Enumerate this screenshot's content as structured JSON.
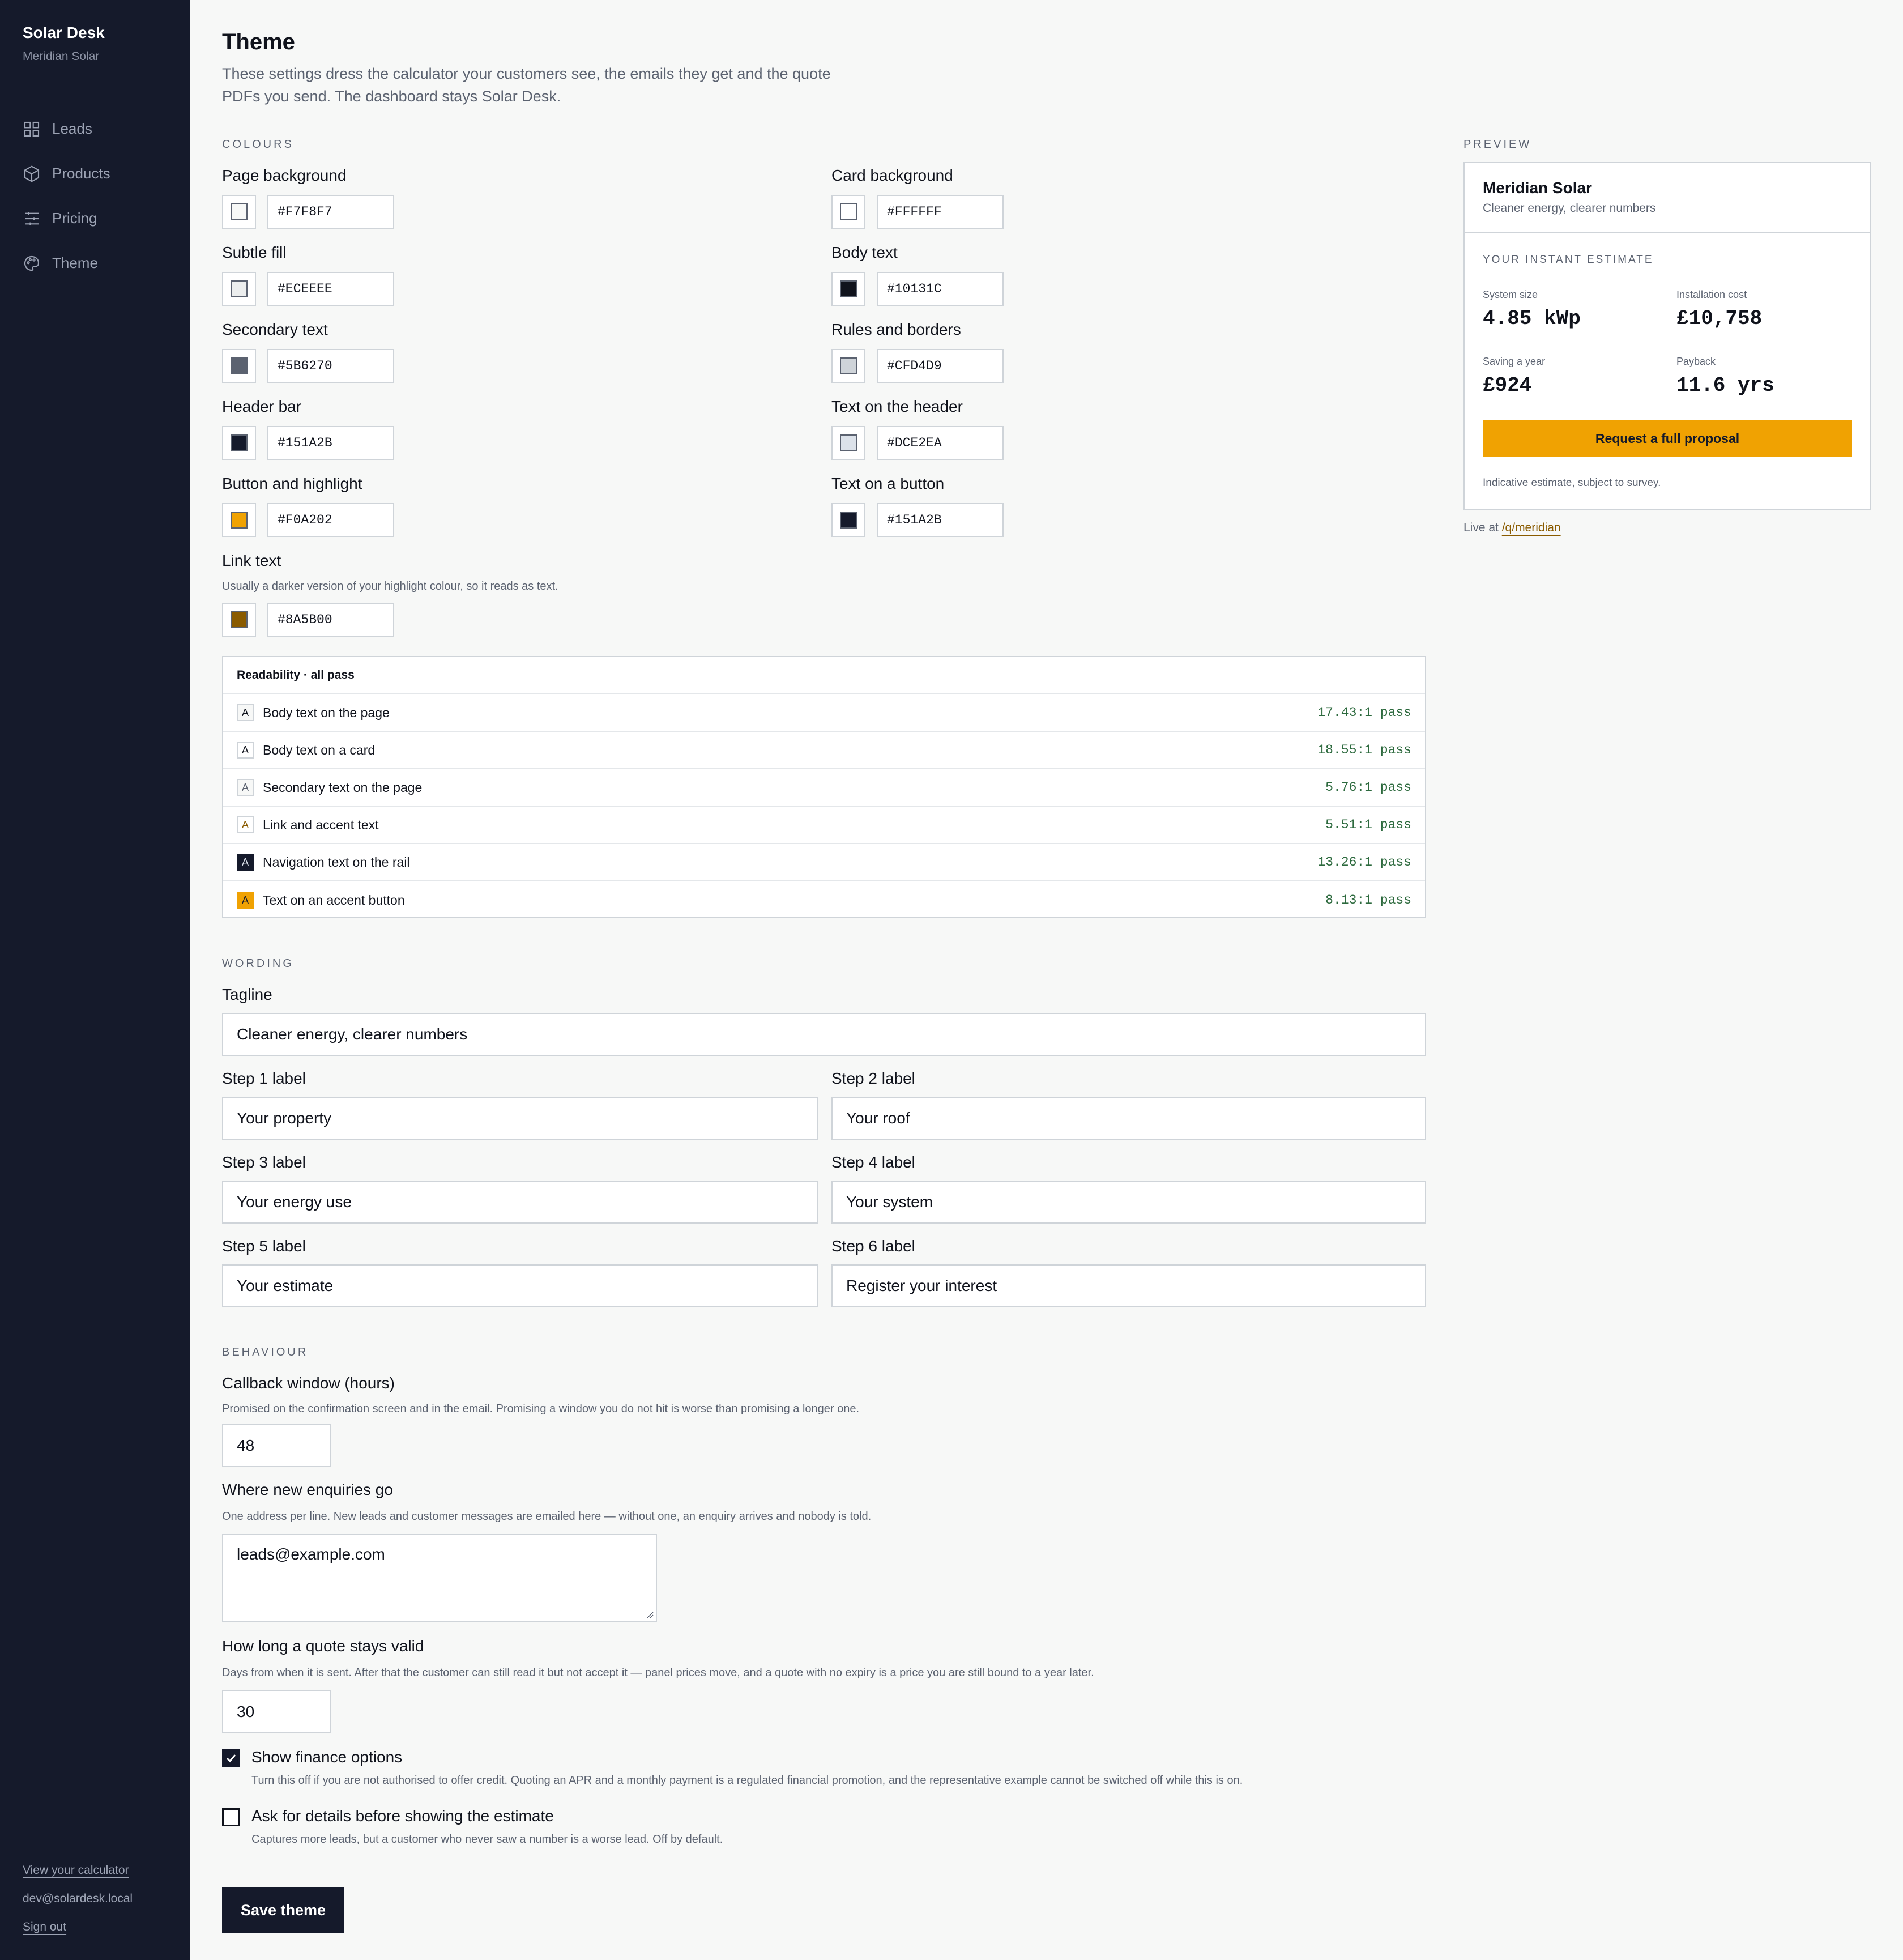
{
  "sidebar": {
    "brand": "Solar Desk",
    "company": "Meridian Solar",
    "items": [
      {
        "label": "Leads",
        "icon": "grid-icon"
      },
      {
        "label": "Products",
        "icon": "box-icon"
      },
      {
        "label": "Pricing",
        "icon": "sliders-icon"
      },
      {
        "label": "Theme",
        "icon": "palette-icon"
      }
    ],
    "footer": {
      "view_calculator": "View your calculator",
      "email": "dev@solardesk.local",
      "sign_out": "Sign out"
    }
  },
  "page": {
    "title": "Theme",
    "intro": "These settings dress the calculator your customers see, the emails they get and the quote PDFs you send. The dashboard stays Solar Desk."
  },
  "colours": {
    "section_label": "COLOURS",
    "page_background": {
      "label": "Page background",
      "value": "#F7F8F7"
    },
    "card_background": {
      "label": "Card background",
      "value": "#FFFFFF"
    },
    "subtle_fill": {
      "label": "Subtle fill",
      "value": "#ECEEEE"
    },
    "body_text": {
      "label": "Body text",
      "value": "#10131C"
    },
    "secondary_text": {
      "label": "Secondary text",
      "value": "#5B6270"
    },
    "rules_borders": {
      "label": "Rules and borders",
      "value": "#CFD4D9"
    },
    "header_bar": {
      "label": "Header bar",
      "value": "#151A2B"
    },
    "text_on_header": {
      "label": "Text on the header",
      "value": "#DCE2EA"
    },
    "button_highlight": {
      "label": "Button and highlight",
      "value": "#F0A202"
    },
    "text_on_button": {
      "label": "Text on a button",
      "value": "#151A2B"
    },
    "link_text": {
      "label": "Link text",
      "help": "Usually a darker version of your highlight colour, so it reads as text.",
      "value": "#8A5B00"
    }
  },
  "readability": {
    "title": "Readability · all pass",
    "rows": [
      {
        "label": "Body text on the page",
        "ratio": "17.43:1 pass"
      },
      {
        "label": "Body text on a card",
        "ratio": "18.55:1 pass"
      },
      {
        "label": "Secondary text on the page",
        "ratio": "5.76:1 pass"
      },
      {
        "label": "Link and accent text",
        "ratio": "5.51:1 pass"
      },
      {
        "label": "Navigation text on the rail",
        "ratio": "13.26:1 pass"
      },
      {
        "label": "Text on an accent button",
        "ratio": "8.13:1 pass"
      }
    ]
  },
  "wording": {
    "section_label": "WORDING",
    "tagline": {
      "label": "Tagline",
      "value": "Cleaner energy, clearer numbers"
    },
    "steps": [
      {
        "label": "Step 1 label",
        "value": "Your property"
      },
      {
        "label": "Step 2 label",
        "value": "Your roof"
      },
      {
        "label": "Step 3 label",
        "value": "Your energy use"
      },
      {
        "label": "Step 4 label",
        "value": "Your system"
      },
      {
        "label": "Step 5 label",
        "value": "Your estimate"
      },
      {
        "label": "Step 6 label",
        "value": "Register your interest"
      }
    ]
  },
  "behaviour": {
    "section_label": "BEHAVIOUR",
    "callback": {
      "label": "Callback window (hours)",
      "help": "Promised on the confirmation screen and in the email. Promising a window you do not hit is worse than promising a longer one.",
      "value": "48"
    },
    "enquiries": {
      "label": "Where new enquiries go",
      "help": "One address per line. New leads and customer messages are emailed here — without one, an enquiry arrives and nobody is told.",
      "value": "leads@example.com"
    },
    "validity": {
      "label": "How long a quote stays valid",
      "help": "Days from when it is sent. After that the customer can still read it but not accept it — panel prices move, and a quote with no expiry is a price you are still bound to a year later.",
      "value": "30"
    },
    "finance": {
      "label": "Show finance options",
      "help": "Turn this off if you are not authorised to offer credit. Quoting an APR and a monthly payment is a regulated financial promotion, and the representative example cannot be switched off while this is on.",
      "checked": true
    },
    "details_first": {
      "label": "Ask for details before showing the estimate",
      "help": "Captures more leads, but a customer who never saw a number is a worse lead. Off by default.",
      "checked": false
    },
    "save_label": "Save theme"
  },
  "preview": {
    "section_label": "PREVIEW",
    "company": "Meridian Solar",
    "tagline": "Cleaner energy, clearer numbers",
    "estimate_label": "YOUR INSTANT ESTIMATE",
    "stats": [
      {
        "label": "System size",
        "value": "4.85 kWp"
      },
      {
        "label": "Installation cost",
        "value": "£10,758"
      },
      {
        "label": "Saving a year",
        "value": "£924"
      },
      {
        "label": "Payback",
        "value": "11.6 yrs"
      }
    ],
    "cta": "Request a full proposal",
    "disclaimer": "Indicative estimate, subject to survey.",
    "live_prefix": "Live at",
    "live_link": "/q/meridian"
  }
}
